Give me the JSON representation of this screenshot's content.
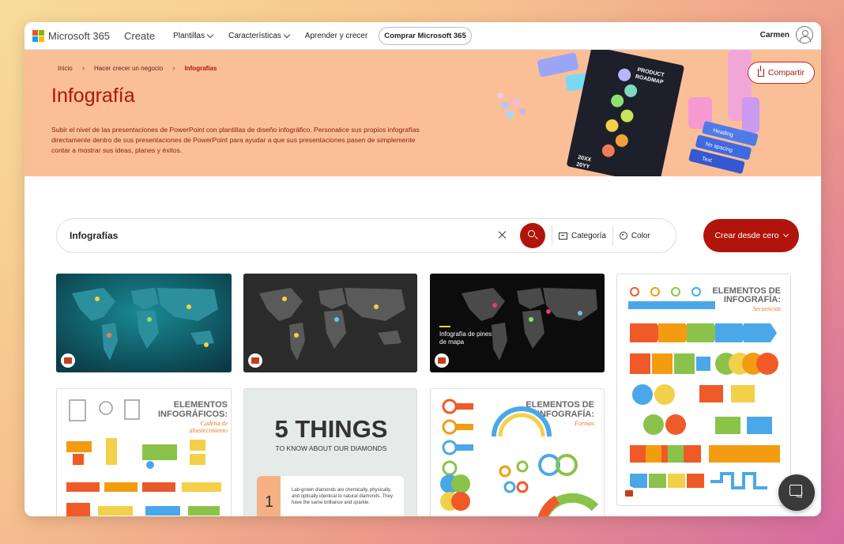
{
  "nav": {
    "brand": "Microsoft 365",
    "create": "Create",
    "items": [
      {
        "label": "Plantillas",
        "has_menu": true
      },
      {
        "label": "Características",
        "has_menu": true
      },
      {
        "label": "Aprender y crecer",
        "has_menu": false
      }
    ],
    "buy_button": "Comprar Microsoft 365",
    "user_name": "Carmen"
  },
  "breadcrumb": {
    "items": [
      "Inicio",
      "Hacer crecer un negocio",
      "Infografías"
    ]
  },
  "hero": {
    "title": "Infografía",
    "description": "Subir el nivel de las presentaciones de PowerPoint con plantillas de diseño infográfico. Personalice sus propios infografías directamente dentro de sus presentaciones de PowerPoint para ayudar a que sus presentaciones pasen de simplemente contar a mostrar sus ideas, planes y éxitos.",
    "share_button": "Compartir",
    "art_texts": {
      "roadmap_title": "PRODUCT ROADMAP",
      "roadmap_year_a": "20XX",
      "roadmap_year_b": "20YY",
      "block_1": "Heading",
      "block_2": "No spacing",
      "block_3": "Text"
    }
  },
  "search": {
    "value": "Infografías",
    "category_label": "Categoría",
    "color_label": "Color",
    "create_button": "Crear desde cero"
  },
  "templates": [
    {
      "name": "World map teal",
      "style": "map-teal"
    },
    {
      "name": "World map gray",
      "style": "map-gray"
    },
    {
      "name": "Infografía de pines de mapa",
      "style": "map-black",
      "title_text": "Infografía de pines de mapa"
    },
    {
      "name": "Elementos de infografía secuencias",
      "style": "sequences",
      "title_text": "ELEMENTOS DE INFOGRAFÍA:",
      "subtitle_text": "Secuencias"
    },
    {
      "name": "Elementos infográficos cadena de abastecimiento",
      "style": "supply",
      "title_text": "ELEMENTOS INFOGRÁFICOS:",
      "subtitle_text": "Cadena de abastecimiento"
    },
    {
      "name": "5 things diamonds",
      "style": "five-things",
      "title_text": "5 THINGS",
      "subtitle_text": "TO KNOW ABOUT OUR DIAMONDS",
      "item_number": "1",
      "item_text": "Lab-grown diamonds are chemically, physically, and optically identical to natural diamonds. They have the same brilliance and sparkle."
    },
    {
      "name": "Elementos de infografía formas",
      "style": "shapes",
      "title_text": "ELEMENTOS DE INFOGRAFÍA:",
      "subtitle_text": "Formas"
    }
  ],
  "colors": {
    "accent": "#b0140a",
    "hero_bg": "#fbbf97",
    "ppt": "#c43e1c"
  }
}
